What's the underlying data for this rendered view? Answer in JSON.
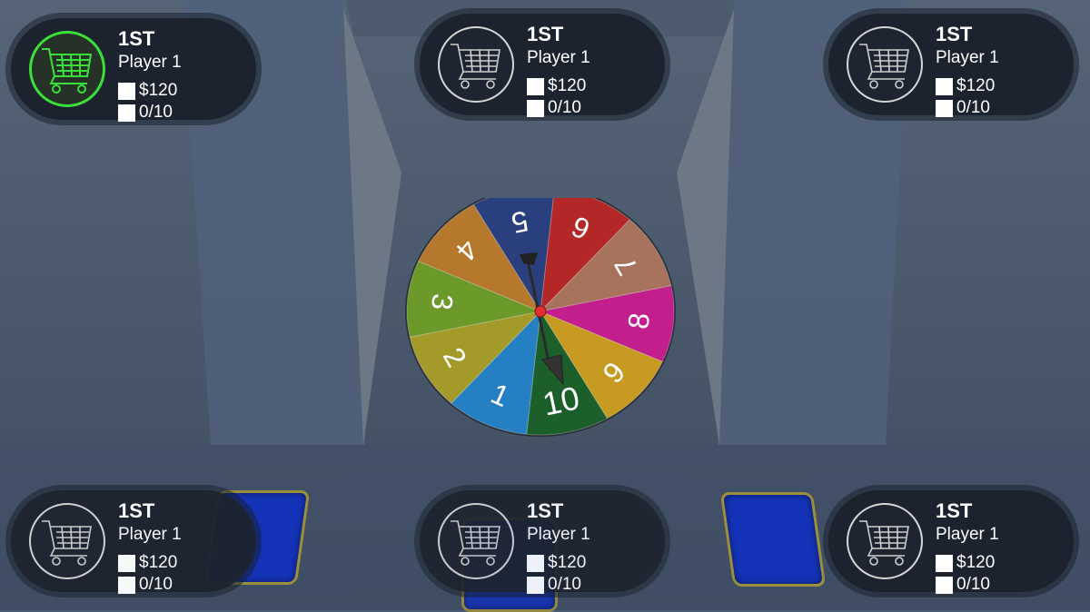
{
  "colors": {
    "background": "#4a5a70",
    "panel": "#1d232e",
    "active_ring": "#3ae03a",
    "card_blue": "#1433b8"
  },
  "players": [
    {
      "rank": "1ST",
      "name": "Player 1",
      "money": "$120",
      "progress": "0/10",
      "active": true
    },
    {
      "rank": "1ST",
      "name": "Player 1",
      "money": "$120",
      "progress": "0/10",
      "active": false
    },
    {
      "rank": "1ST",
      "name": "Player 1",
      "money": "$120",
      "progress": "0/10",
      "active": false
    },
    {
      "rank": "1ST",
      "name": "Player 1",
      "money": "$120",
      "progress": "0/10",
      "active": false
    },
    {
      "rank": "1ST",
      "name": "Player 1",
      "money": "$120",
      "progress": "0/10",
      "active": false
    },
    {
      "rank": "1ST",
      "name": "Player 1",
      "money": "$120",
      "progress": "0/10",
      "active": false
    }
  ],
  "wheel": {
    "pointer_value": "10",
    "segments": [
      {
        "label": "6",
        "color": "#b42727"
      },
      {
        "label": "7",
        "color": "#a7735c"
      },
      {
        "label": "8",
        "color": "#c21f8c"
      },
      {
        "label": "9",
        "color": "#c79a22"
      },
      {
        "label": "10",
        "color": "#1d5f2a"
      },
      {
        "label": "1",
        "color": "#2480c2"
      },
      {
        "label": "2",
        "color": "#a49a2a"
      },
      {
        "label": "3",
        "color": "#6c9a2a"
      },
      {
        "label": "4",
        "color": "#b6782c"
      },
      {
        "label": "5",
        "color": "#2a3f7e"
      }
    ]
  },
  "icons": {
    "avatar": "shopping-cart-icon",
    "spinner": "arrow-pointer-icon"
  }
}
